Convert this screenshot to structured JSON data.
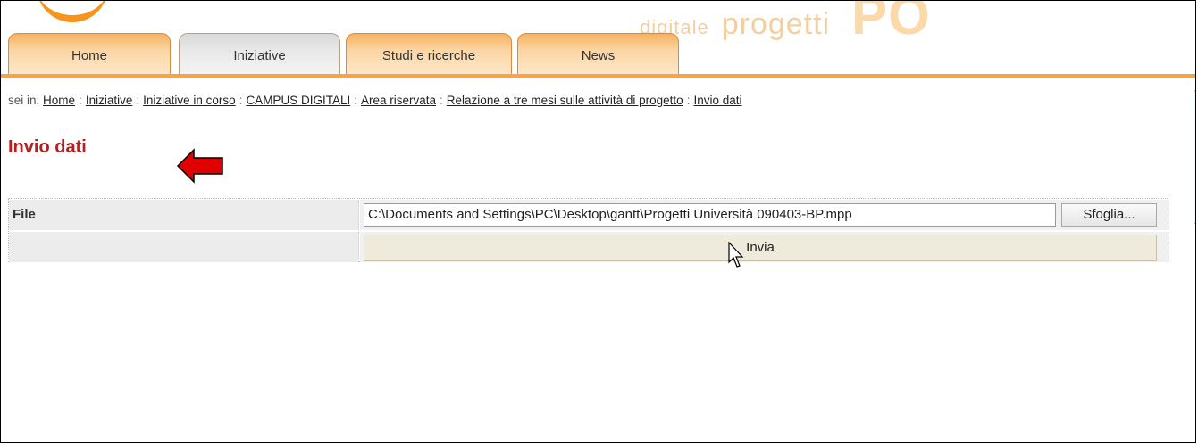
{
  "header": {
    "tagline_small": "digitale",
    "tagline_mid": "progetti",
    "tagline_big": "PO"
  },
  "tabs": [
    {
      "label": "Home"
    },
    {
      "label": "Iniziative"
    },
    {
      "label": "Studi e ricerche"
    },
    {
      "label": "News"
    }
  ],
  "breadcrumb": {
    "prefix": "sei in:",
    "items": [
      "Home",
      "Iniziative",
      "Iniziative in corso",
      "CAMPUS DIGITALI",
      "Area riservata",
      "Relazione a tre mesi sulle attività di progetto",
      "Invio dati"
    ]
  },
  "page": {
    "title": "Invio dati"
  },
  "form": {
    "file_label": "File",
    "file_value": "C:\\Documents and Settings\\PC\\Desktop\\gantt\\Progetti Università 090403-BP.mpp",
    "browse_label": "Sfoglia...",
    "submit_label": "Invia"
  },
  "colors": {
    "accent": "#f7a34a",
    "title": "#b22222",
    "arrow": "#e00000"
  }
}
